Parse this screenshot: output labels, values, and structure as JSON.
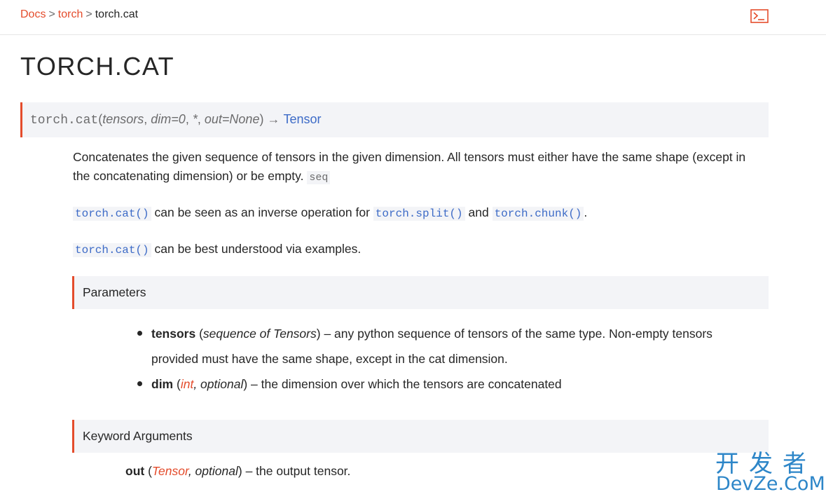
{
  "breadcrumb": {
    "items": [
      "Docs",
      "torch"
    ],
    "separator": ">",
    "current": "torch.cat"
  },
  "page_title": "TORCH.CAT",
  "signature": {
    "func": "torch.cat",
    "open": "(",
    "param1": "tensors",
    "comma1": ",",
    "param2": "dim=0",
    "comma2": ",",
    "star": "*",
    "comma3": ",",
    "param3": "out=None",
    "close": ")",
    "arrow": "→",
    "return_type": "Tensor"
  },
  "description": {
    "text": "Concatenates the given sequence of tensors in the given dimension. All tensors must either have the same shape (except in the concatenating dimension) or be empty.",
    "seq_code": "seq"
  },
  "inverse_line": {
    "code1": "torch.cat()",
    "text1": "can be seen as an inverse operation for",
    "code2": "torch.split()",
    "text2": "and",
    "code3": "torch.chunk()",
    "end": "."
  },
  "examples_line": {
    "code": "torch.cat()",
    "text": "can be best understood via examples."
  },
  "parameters": {
    "heading": "Parameters",
    "items": [
      {
        "name": "tensors",
        "open": "(",
        "type": "sequence of Tensors",
        "close": ")",
        "desc": "– any python sequence of tensors of the same type. Non-empty tensors provided must have the same shape, except in the cat dimension."
      },
      {
        "name": "dim",
        "open": "(",
        "type_link": "int",
        "type_rest": ", optional",
        "close": ")",
        "desc": "– the dimension over which the tensors are concatenated"
      }
    ]
  },
  "keyword_arguments": {
    "heading": "Keyword Arguments",
    "name": "out",
    "open": "(",
    "type_link": "Tensor",
    "type_rest": ", optional",
    "close": ")",
    "desc": "– the output tensor."
  },
  "watermark": {
    "cn": "开发者",
    "en": "DevZe.CoM"
  },
  "colors": {
    "accent": "#e44c2c",
    "link": "#3d6bc7",
    "panel": "#f3f4f7",
    "watermark": "#2d86c8"
  },
  "icons": {
    "terminal": "terminal-icon"
  }
}
